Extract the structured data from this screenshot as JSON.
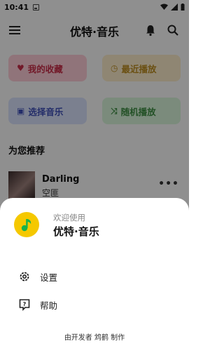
{
  "status_bar": {
    "time": "10:41"
  },
  "app_bar": {
    "title": "优特·音乐"
  },
  "tiles": {
    "favorites": "我的收藏",
    "recent": "最近播放",
    "select_music": "选择音乐",
    "random_play": "随机播放"
  },
  "recommend": {
    "section_title": "为您推荐",
    "song": {
      "title": "Darling",
      "artist": "空匪",
      "more": "•••"
    }
  },
  "sheet": {
    "welcome": "欢迎使用",
    "app_name": "优特·音乐",
    "items": [
      {
        "label": "设置",
        "icon": "gear-icon"
      },
      {
        "label": "帮助",
        "icon": "help-icon"
      }
    ],
    "footer": "由开发者 鸩鹤 制作"
  },
  "colors": {
    "fav": "#c52b47",
    "recent": "#b88a20",
    "select": "#3d4fb5",
    "random": "#3d8c42",
    "logo": "#f5c800"
  }
}
